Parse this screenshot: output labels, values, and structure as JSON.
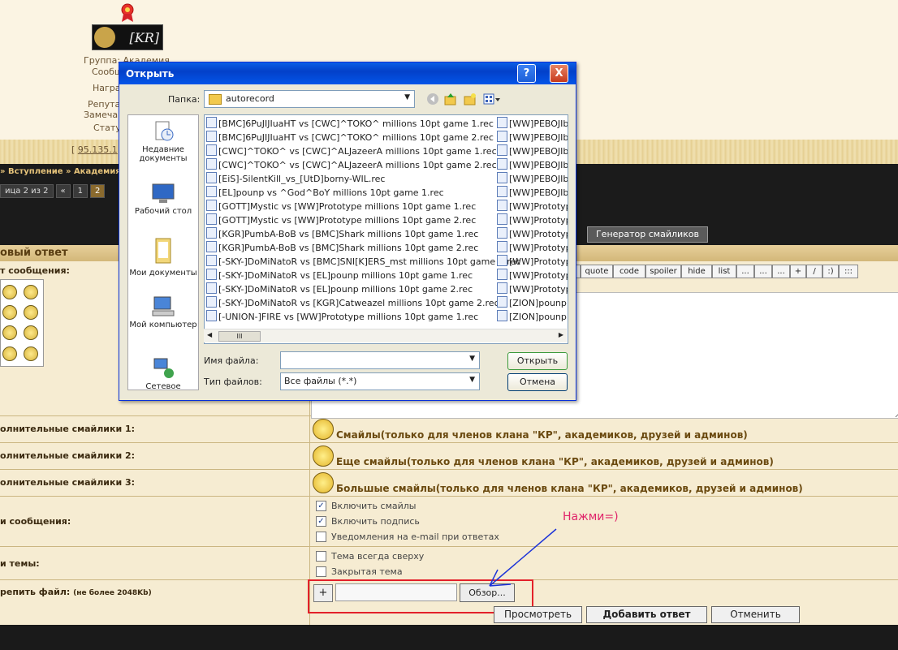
{
  "forum": {
    "side_info": [
      "Группа: Академия",
      "Сообщ",
      "Награ",
      "Репута",
      "Замеча",
      "Стату"
    ],
    "ip_prefix": "[",
    "ip": "95.135.1",
    "breadcrumb": "» Вступление » Академия »",
    "pager_label": "ица 2 из 2",
    "pager_items": [
      "«",
      "1",
      "2"
    ],
    "smiley_generator": "Генератор смайликов",
    "reply_title": "овый ответ",
    "message_label": "т сообщения:",
    "tags": [
      "quote",
      "code",
      "spoiler",
      "hide",
      "list",
      "...",
      "...",
      "...",
      "+",
      "/",
      ":)",
      ":::"
    ],
    "extra_smileys": [
      {
        "label": "олнительные смайлики 1:",
        "link": "Смайлы(только для членов клана \"КР\", академиков, друзей и админов)"
      },
      {
        "label": "олнительные смайлики 2:",
        "link": "Еще смайлы(только для членов клана \"КР\", академиков, друзей и админов)"
      },
      {
        "label": "олнительные смайлики 3:",
        "link": "Большые смайлы(только для членов клана \"КР\", академиков, друзей и админов)"
      }
    ],
    "message_options_label": "и сообщения:",
    "message_options": [
      {
        "label": "Включить смайлы",
        "checked": true
      },
      {
        "label": "Включить подпись",
        "checked": true
      },
      {
        "label": "Уведомления на e-mail при ответах",
        "checked": false
      }
    ],
    "topic_options_label": "и темы:",
    "topic_options": [
      {
        "label": "Тема всегда сверху",
        "checked": false
      },
      {
        "label": "Закрытая тема",
        "checked": false
      }
    ],
    "attach_label": "репить файл:",
    "attach_note": "(не более 2048Kb)",
    "add_button": "+",
    "browse_button": "Обзор...",
    "hint": "Нажми=)",
    "preview_button": "Просмотреть",
    "submit_button": "Добавить ответ",
    "cancel_button": "Отменить",
    "logo_text": "[KR]",
    "check_mark": "✓"
  },
  "dialog": {
    "title": "Открыть",
    "help": "?",
    "close": "X",
    "folder_label": "Папка:",
    "folder_value": "autorecord",
    "places": [
      "Недавние документы",
      "Рабочий стол",
      "Мои документы",
      "Мой компьютер",
      "Сетевое"
    ],
    "files_left": [
      "[BMC]6PuJIJIuaHT vs [CWC]^TOKO^ millions 10pt  game 1.rec",
      "[BMC]6PuJIJIuaHT vs [CWC]^TOKO^ millions 10pt  game 2.rec",
      "[CWC]^TOKO^ vs [CWC]^ALJazeerA  millions 10pt  game 1.rec",
      "[CWC]^TOKO^ vs [CWC]^ALJazeerA  millions 10pt  game 2.rec",
      "[EiS]-SilentKill_vs_[UtD]borny-WIL.rec",
      "[EL]pounp vs ^God^BoY  millions 10pt  game 1.rec",
      "[GOTT]Mystic vs [WW]Prototype  millions 10pt  game 1.rec",
      "[GOTT]Mystic vs [WW]Prototype  millions 10pt  game 2.rec",
      "[KGR]PumbA-BoB vs [BMC]Shark  millions 10pt  game 1.rec",
      "[KGR]PumbA-BoB vs [BMC]Shark  millions 10pt  game 2.rec",
      "[-SKY-]DoMiNatoR vs [BMC]SNI[K]ERS_mst  millions 10pt  game 1.rec",
      "[-SKY-]DoMiNatoR vs [EL]pounp  millions 10pt  game 1.rec",
      "[-SKY-]DoMiNatoR vs [EL]pounp  millions 10pt  game 2.rec",
      "[-SKY-]DoMiNatoR vs [KGR]Catweazel  millions 10pt  game 2.rec",
      "[-UNION-]FIRE vs [WW]Prototype  millions 10pt  game 1.rec"
    ],
    "files_right": [
      "[WW]PEBOJIbI",
      "[WW]PEBOJIbI",
      "[WW]PEBOJIbI",
      "[WW]PEBOJIbI",
      "[WW]PEBOJIbI",
      "[WW]PEBOJIbI",
      "[WW]Prototyp",
      "[WW]Prototyp",
      "[WW]Prototyp",
      "[WW]Prototyp",
      "[WW]Prototyp",
      "[WW]Prototyp",
      "[WW]Prototyp",
      "[ZION]pounp v",
      "[ZION]pounp v"
    ],
    "filename_label": "Имя файла:",
    "filename_value": "",
    "filetype_label": "Тип файлов:",
    "filetype_value": "Все файлы (*.*)",
    "open_button": "Открыть",
    "cancel_button": "Отмена",
    "scroll_left": "◀",
    "scroll_right": "▶",
    "scroll_thumb": "III",
    "combo_arrow": "▼"
  }
}
